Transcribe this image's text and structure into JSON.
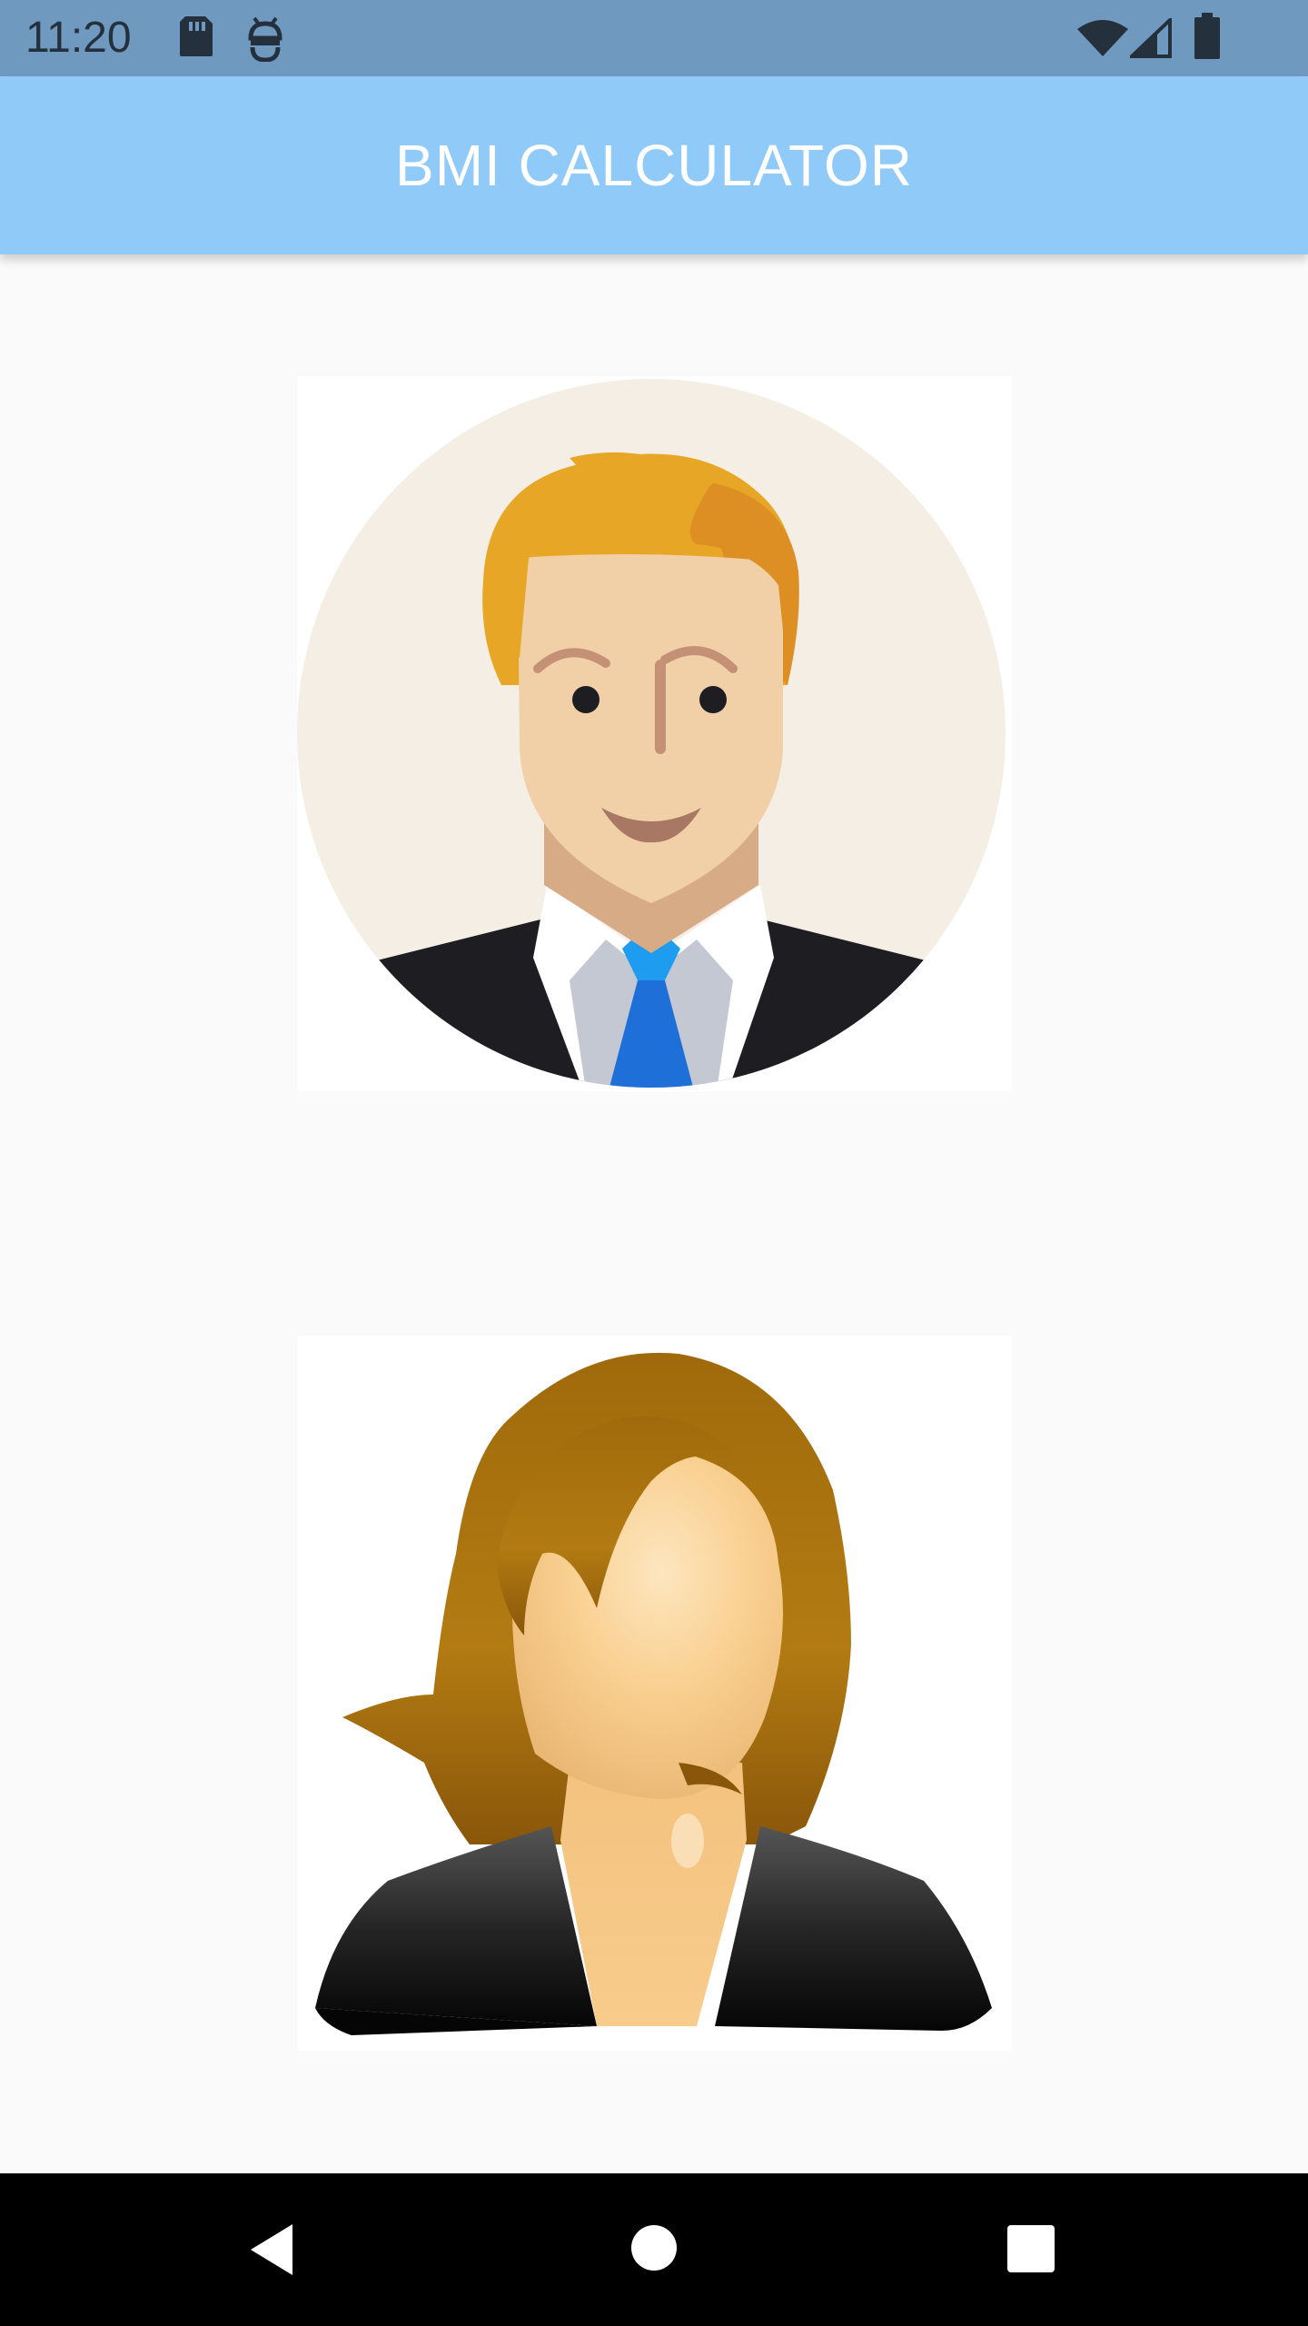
{
  "status_bar": {
    "time": "11:20",
    "icons": [
      "sd-card-icon",
      "debug-icon",
      "wifi-icon",
      "signal-icon",
      "battery-icon"
    ]
  },
  "app_bar": {
    "title": "BMI CALCULATOR"
  },
  "main": {
    "options": [
      {
        "icon": "male-avatar-icon"
      },
      {
        "icon": "female-avatar-icon"
      }
    ]
  },
  "nav_bar": {
    "buttons": [
      "back-icon",
      "home-icon",
      "recents-icon"
    ]
  },
  "colors": {
    "status_bar": "#6f99bf",
    "app_bar": "#90caf9",
    "background": "#fafafa",
    "nav_bar": "#000000"
  }
}
